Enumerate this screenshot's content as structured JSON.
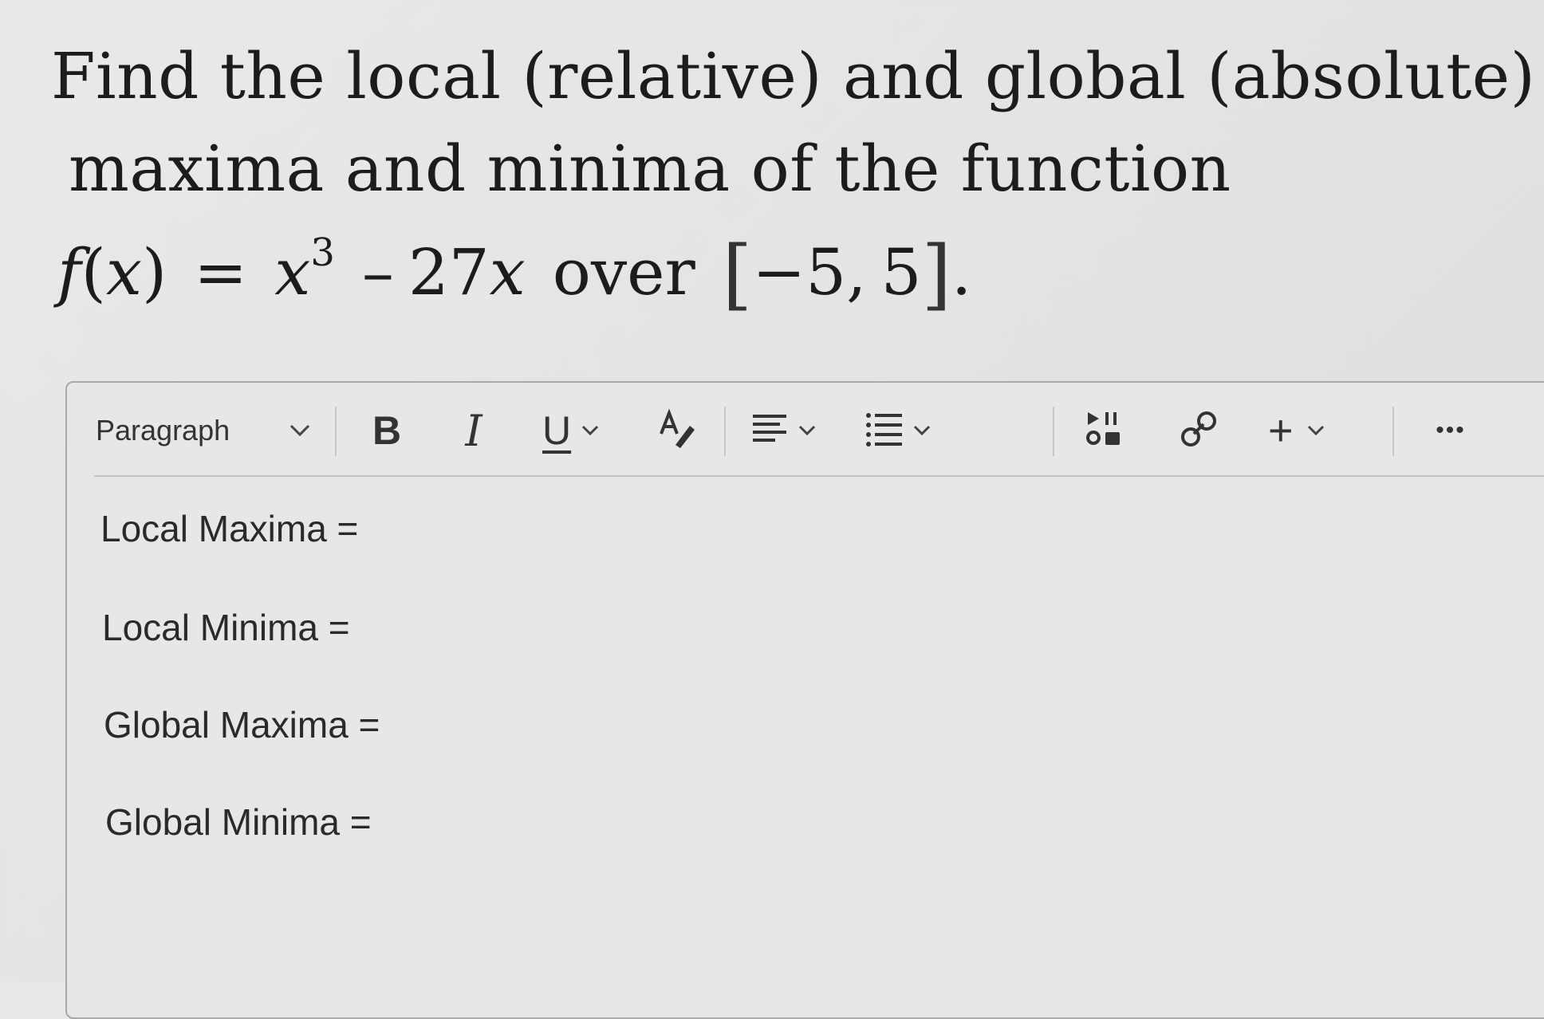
{
  "question": {
    "line1": "Find the local (relative) and global (absolute)",
    "line2": "maxima and minima of the function",
    "math": {
      "f": "f",
      "lparen": "(",
      "x": "x",
      "rparen": ")",
      "equals": "=",
      "x2": "x",
      "exponent": "3",
      "minus": "–",
      "coef": "27",
      "x3": "x",
      "over": "over",
      "lbracket": "[",
      "interval_start": "−5,",
      "interval_end": "5",
      "rbracket": "]",
      "period": "."
    }
  },
  "toolbar": {
    "paragraph_label": "Paragraph",
    "bold_label": "B",
    "italic_label": "I",
    "underline_label": "U",
    "more_label": "•••",
    "plus_label": "+",
    "icons": {
      "paragraph_dropdown": "chevron-down-icon",
      "text_color": "text-color-icon",
      "align": "align-left-icon",
      "list": "list-icon",
      "media": "insert-media-icon",
      "link": "link-icon",
      "insert": "plus-icon",
      "more": "more-options-icon"
    }
  },
  "content": {
    "lines": [
      "Local Maxima =",
      "Local Minima =",
      "Global Maxima =",
      "Global Minima ="
    ]
  },
  "colors": {
    "background": "#e6e6e4",
    "editor_border": "#a9a9a9",
    "text": "#222222"
  }
}
